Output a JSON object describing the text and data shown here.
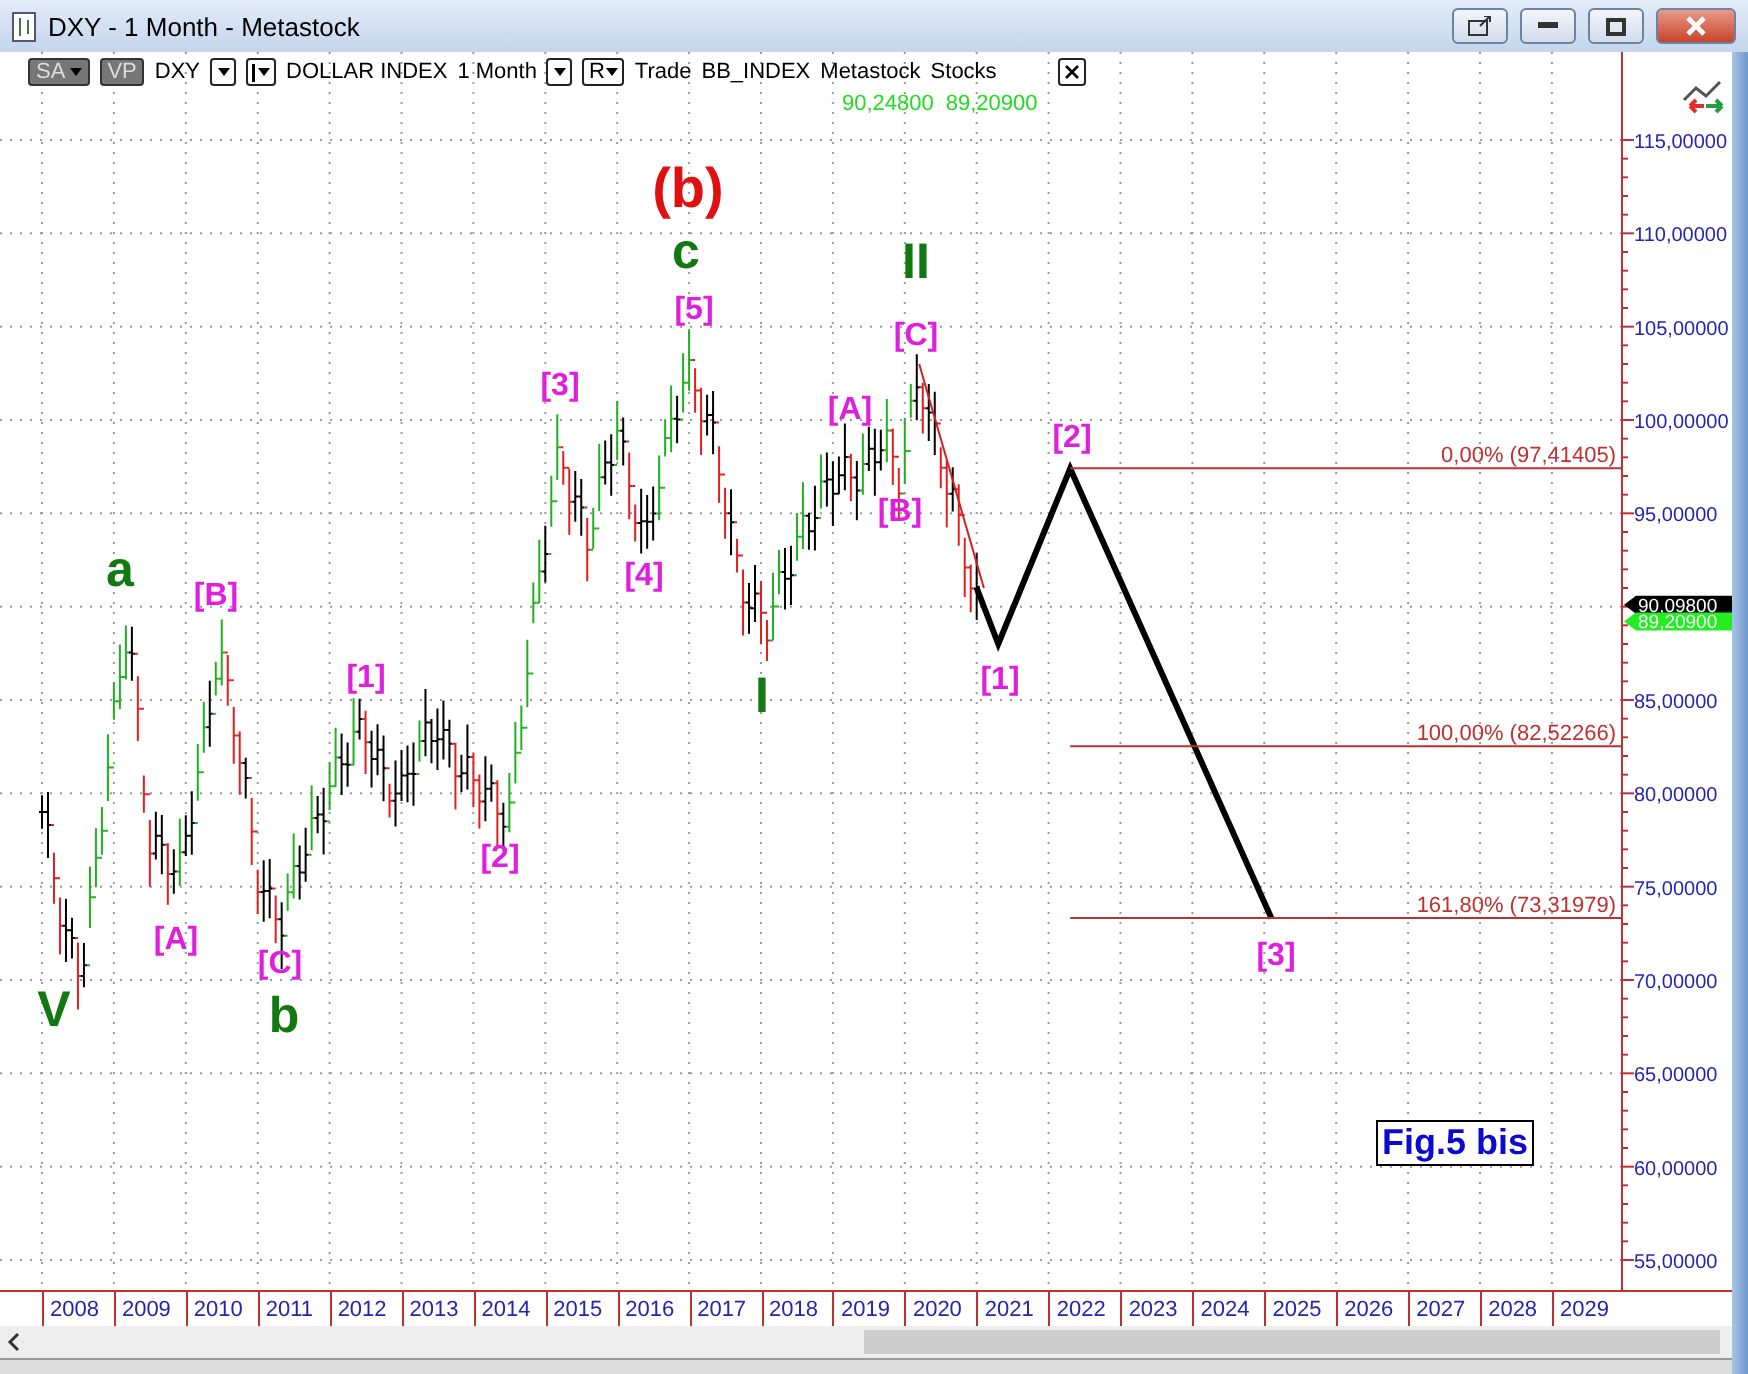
{
  "window": {
    "title": "DXY - 1 Month - Metastock"
  },
  "toolbar": {
    "items": [
      {
        "kind": "dark",
        "text": "SA",
        "caret": true
      },
      {
        "kind": "dark",
        "text": "VP",
        "caret": false
      },
      {
        "kind": "text",
        "text": "DXY"
      },
      {
        "kind": "dropdown"
      },
      {
        "kind": "indicator"
      },
      {
        "kind": "text",
        "text": "DOLLAR INDEX"
      },
      {
        "kind": "text",
        "text": "1 Month"
      },
      {
        "kind": "dropdown"
      },
      {
        "kind": "box",
        "text": "R"
      },
      {
        "kind": "text",
        "text": "Trade"
      },
      {
        "kind": "text",
        "text": "BB_INDEX"
      },
      {
        "kind": "text",
        "text": "Metastock"
      },
      {
        "kind": "text",
        "text": "Stocks"
      }
    ],
    "readings": [
      "90,24800",
      "89,20900"
    ]
  },
  "y_axis": {
    "labels": [
      "115,00000",
      "110,00000",
      "105,00000",
      "100,00000",
      "95,00000",
      "85,00000",
      "80,00000",
      "75,00000",
      "70,00000",
      "65,00000",
      "60,00000",
      "55,00000"
    ]
  },
  "price_tags": [
    {
      "text": "90,09800",
      "kind": "last"
    },
    {
      "text": "89,20900",
      "kind": "low"
    }
  ],
  "fib_levels": [
    {
      "label": "0,00% (97,41405)"
    },
    {
      "label": "100,00% (82,52266)"
    },
    {
      "label": "161,80% (73,31979)"
    }
  ],
  "wave_labels": [
    {
      "text": "V",
      "kind": "primary"
    },
    {
      "text": "a",
      "kind": "primary"
    },
    {
      "text": "[A]",
      "kind": "minor"
    },
    {
      "text": "[B]",
      "kind": "minor"
    },
    {
      "text": "b",
      "kind": "primary"
    },
    {
      "text": "[C]",
      "kind": "minor"
    },
    {
      "text": "[1]",
      "kind": "minor"
    },
    {
      "text": "[2]",
      "kind": "minor"
    },
    {
      "text": "[3]",
      "kind": "minor"
    },
    {
      "text": "[4]",
      "kind": "minor"
    },
    {
      "text": "(b)",
      "kind": "intermediate"
    },
    {
      "text": "c",
      "kind": "primary"
    },
    {
      "text": "[5]",
      "kind": "minor"
    },
    {
      "text": "I",
      "kind": "primary"
    },
    {
      "text": "[A]",
      "kind": "minor"
    },
    {
      "text": "[B]",
      "kind": "minor"
    },
    {
      "text": "[C]",
      "kind": "minor"
    },
    {
      "text": "II",
      "kind": "primary"
    },
    {
      "text": "[1]",
      "kind": "minor"
    },
    {
      "text": "[2]",
      "kind": "minor"
    },
    {
      "text": "[3]",
      "kind": "minor"
    }
  ],
  "figure_label": "Fig.5 bis",
  "x_axis": {
    "years": [
      "2008",
      "2009",
      "2010",
      "2011",
      "2012",
      "2013",
      "2014",
      "2015",
      "2016",
      "2017",
      "2018",
      "2019",
      "2020",
      "2021",
      "2022",
      "2023",
      "2024",
      "2025",
      "2026",
      "2027",
      "2028",
      "2029"
    ]
  }
}
